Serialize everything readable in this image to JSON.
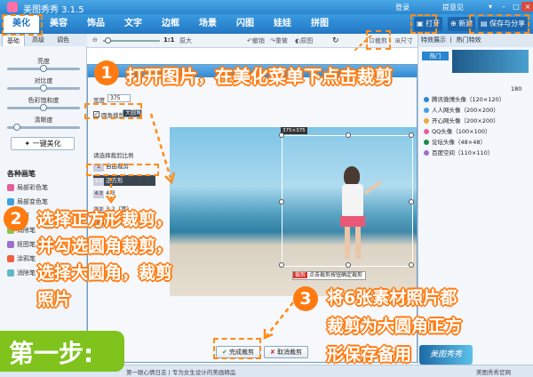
{
  "titlebar": {
    "title": "美图秀秀 3.1.5",
    "login": "登录",
    "hint": "提意见"
  },
  "menu": {
    "tabs": [
      "美化",
      "美容",
      "饰品",
      "文字",
      "边框",
      "场景",
      "闪图",
      "娃娃",
      "拼图"
    ],
    "active": "美化",
    "open_label": "打开",
    "new_label": "新建",
    "save_label": "保存与分享"
  },
  "left_panel": {
    "subtabs": [
      "基础",
      "高级",
      "调色"
    ],
    "sliders": [
      {
        "label": "亮度",
        "value": 0.5
      },
      {
        "label": "对比度",
        "value": 0.5
      },
      {
        "label": "色彩饱和度",
        "value": 0.5
      },
      {
        "label": "清晰度",
        "value": 0.1
      }
    ],
    "one_key": "一键美化",
    "brush_header": "各种画笔",
    "brushes": [
      "局部彩色笔",
      "局部变色笔",
      "祛斑",
      "消除笔",
      "抠图笔",
      "涂鸦笔",
      "消除笔"
    ]
  },
  "canvas_tools": {
    "zoom": "1:1",
    "original": "原大",
    "undo": "撤销",
    "redo": "重做",
    "bg": "原图",
    "crop": "裁剪",
    "resize": "尺寸"
  },
  "right_panel": {
    "header": "特效展示 丨 热门特效",
    "items": [
      "热门",
      "腾讯微博头像（120×120）",
      "人人网头像（200×200）",
      "开心网头像（200×200）",
      "QQ头像（100×100）",
      "论坛头像（48×48）",
      "百度空间（110×110）"
    ],
    "top_value": "180"
  },
  "dialog": {
    "width_label": "宽度",
    "width_value": "375",
    "lock_label": "锁定比例",
    "round_corner_label": "圆角裁剪",
    "round_corner_mode": "大圆角",
    "ratio_header": "请选择裁剪比例",
    "ratios": [
      {
        "key": "1",
        "label": "自由裁剪"
      },
      {
        "key": "1:1",
        "label": "正方形"
      },
      {
        "key": "4:3",
        "label": "4:3"
      },
      {
        "key": "3:2",
        "label": "3:2（宽）"
      },
      {
        "key": "16:9",
        "label": "单...神机"
      }
    ],
    "crop_size": "375×375",
    "crop_hint_red": "裁剪",
    "crop_hint": "点击裁剪按钮确定裁剪",
    "ok_button": "完成裁剪",
    "cancel_button": "取消裁剪"
  },
  "annotations": {
    "step1_num": "1",
    "step1_text": "打开图片，在美化菜单下点击裁剪",
    "step2_num": "2",
    "step2_lines": [
      "选择正方形裁剪，",
      "并勾选圆角裁剪，",
      "选择大圆角，裁剪",
      "照片"
    ],
    "step3_num": "3",
    "step3_lines": [
      "将6张素材照片都",
      "裁剪为大圆角正方",
      "形保存备用"
    ],
    "step_badge": "第一步:"
  },
  "statusbar": {
    "left": "图片",
    "tip": "第一眼心情日志 | 专为女生设计的美画精品",
    "brand": "美图秀秀官网",
    "logo_text": "美图秀秀"
  },
  "colors": {
    "accent": "#2477c4",
    "annotation": "#ff7a10",
    "badge": "#7fc31c"
  }
}
